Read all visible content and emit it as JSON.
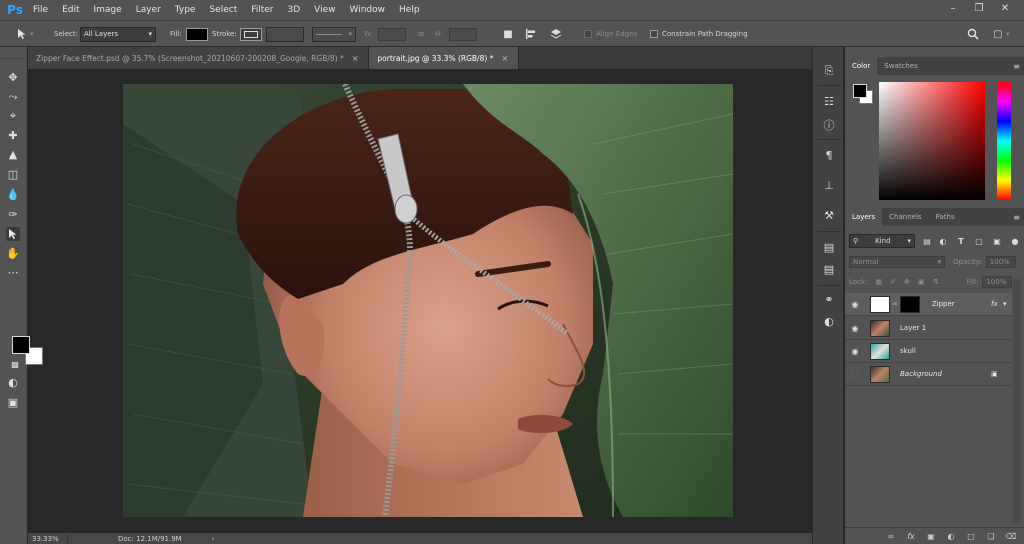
{
  "app": {
    "logo": "Ps"
  },
  "menu": [
    "File",
    "Edit",
    "Image",
    "Layer",
    "Type",
    "Select",
    "Filter",
    "3D",
    "View",
    "Window",
    "Help"
  ],
  "window_controls": [
    "–",
    "❐",
    "✕"
  ],
  "options_bar": {
    "select_label": "Select:",
    "select_value": "All Layers",
    "fill_label": "Fill:",
    "stroke_label": "Stroke:",
    "w_label": "W:",
    "h_label": "H:",
    "align_edges": "Align Edges",
    "constrain": "Constrain Path Dragging"
  },
  "tabs": [
    {
      "label": "Zipper Face Effect.psd @ 35.7% (Screenshot_20210607-200208_Google, RGB/8) *",
      "active": false
    },
    {
      "label": "portrait.jpg @ 33.3% (RGB/8) *",
      "active": true
    }
  ],
  "status": {
    "zoom": "33.33%",
    "doc": "Doc: 12.1M/91.9M"
  },
  "color_panel": {
    "tabs": [
      "Color",
      "Swatches"
    ],
    "fg": "#000000",
    "bg": "#ffffff"
  },
  "layers_panel": {
    "tabs": [
      "Layers",
      "Channels",
      "Paths"
    ],
    "kind": "Kind",
    "blend_mode": "Normal",
    "opacity_label": "Opacity:",
    "opacity_value": "100%",
    "lock_label": "Lock:",
    "fill_label": "Fill:",
    "fill_value": "100%",
    "layers": [
      {
        "name": "Zipper",
        "visible": true,
        "fx": "fx"
      },
      {
        "name": "Layer 1",
        "visible": true
      },
      {
        "name": "skull",
        "visible": true
      },
      {
        "name": "Background",
        "visible": false,
        "locked": true
      }
    ]
  },
  "colors": {
    "accent": "#31a8ff",
    "ui_bg": "#535353",
    "canvas_bg": "#282828"
  }
}
